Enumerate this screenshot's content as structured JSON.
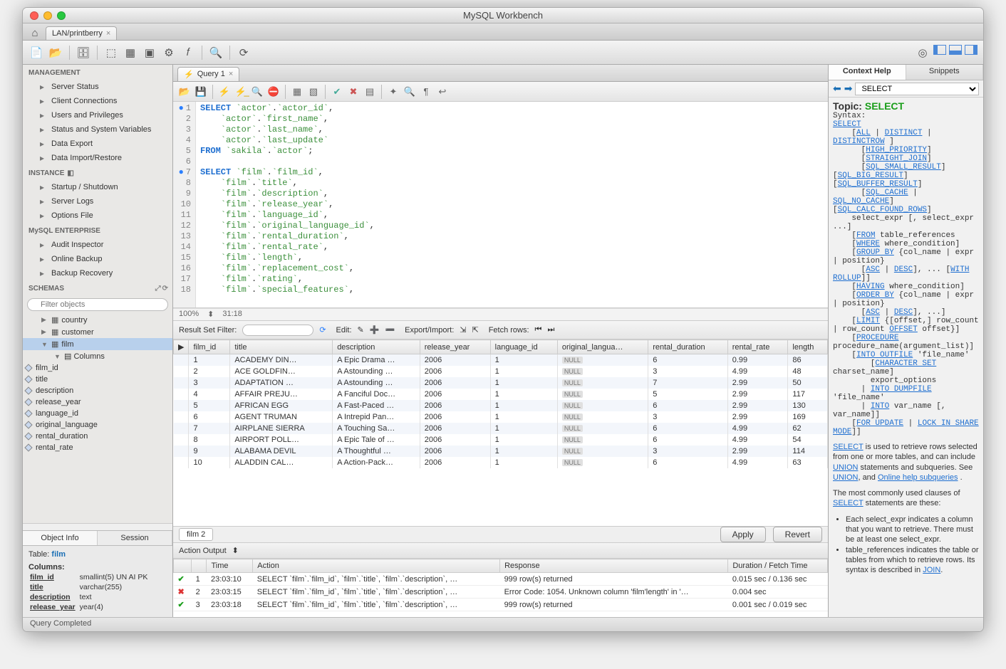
{
  "window_title": "MySQL Workbench",
  "connection_tab": "LAN/printberry",
  "sidebar": {
    "management_header": "MANAGEMENT",
    "management": [
      "Server Status",
      "Client Connections",
      "Users and Privileges",
      "Status and System Variables",
      "Data Export",
      "Data Import/Restore"
    ],
    "instance_header": "INSTANCE",
    "instance": [
      "Startup / Shutdown",
      "Server Logs",
      "Options File"
    ],
    "enterprise_header": "MySQL ENTERPRISE",
    "enterprise": [
      "Audit Inspector",
      "Online Backup",
      "Backup Recovery"
    ],
    "schemas_header": "SCHEMAS",
    "filter_placeholder": "Filter objects",
    "tree": {
      "tables": [
        "country",
        "customer",
        "film"
      ],
      "film_section": "Columns",
      "film_cols": [
        "film_id",
        "title",
        "description",
        "release_year",
        "language_id",
        "original_language",
        "rental_duration",
        "rental_rate"
      ]
    },
    "info_tabs": [
      "Object Info",
      "Session"
    ],
    "object_info": {
      "table_label": "Table:",
      "table_name": "film",
      "columns_label": "Columns:",
      "rows": [
        {
          "name": "film_id",
          "type": "smallint(5) UN AI PK"
        },
        {
          "name": "title",
          "type": "varchar(255)"
        },
        {
          "name": "description",
          "type": "text"
        },
        {
          "name": "release_year",
          "type": "year(4)"
        }
      ]
    }
  },
  "query": {
    "tab": "Query 1",
    "zoom": "100%",
    "cursor": "31:18",
    "lines": [
      {
        "n": 1,
        "dot": true,
        "html": "<span class='kw'>SELECT</span> <span class='bq'>`actor`</span>.<span class='bq'>`actor_id`</span>,"
      },
      {
        "n": 2,
        "html": "    <span class='bq'>`actor`</span>.<span class='bq'>`first_name`</span>,"
      },
      {
        "n": 3,
        "html": "    <span class='bq'>`actor`</span>.<span class='bq'>`last_name`</span>,"
      },
      {
        "n": 4,
        "html": "    <span class='bq'>`actor`</span>.<span class='bq'>`last_update`</span>"
      },
      {
        "n": 5,
        "html": "<span class='kw'>FROM</span> <span class='bq'>`sakila`</span>.<span class='bq'>`actor`</span>;"
      },
      {
        "n": 6,
        "html": ""
      },
      {
        "n": 7,
        "dot": true,
        "html": "<span class='kw'>SELECT</span> <span class='bq'>`film`</span>.<span class='bq'>`film_id`</span>,"
      },
      {
        "n": 8,
        "html": "    <span class='bq'>`film`</span>.<span class='bq'>`title`</span>,"
      },
      {
        "n": 9,
        "html": "    <span class='bq'>`film`</span>.<span class='bq'>`description`</span>,"
      },
      {
        "n": 10,
        "html": "    <span class='bq'>`film`</span>.<span class='bq'>`release_year`</span>,"
      },
      {
        "n": 11,
        "html": "    <span class='bq'>`film`</span>.<span class='bq'>`language_id`</span>,"
      },
      {
        "n": 12,
        "html": "    <span class='bq'>`film`</span>.<span class='bq'>`original_language_id`</span>,"
      },
      {
        "n": 13,
        "html": "    <span class='bq'>`film`</span>.<span class='bq'>`rental_duration`</span>,"
      },
      {
        "n": 14,
        "html": "    <span class='bq'>`film`</span>.<span class='bq'>`rental_rate`</span>,"
      },
      {
        "n": 15,
        "html": "    <span class='bq'>`film`</span>.<span class='bq'>`length`</span>,"
      },
      {
        "n": 16,
        "html": "    <span class='bq'>`film`</span>.<span class='bq'>`replacement_cost`</span>,"
      },
      {
        "n": 17,
        "html": "    <span class='bq'>`film`</span>.<span class='bq'>`rating`</span>,"
      },
      {
        "n": 18,
        "html": "    <span class='bq'>`film`</span>.<span class='bq'>`special_features`</span>,"
      }
    ]
  },
  "rs_filter_label": "Result Set Filter:",
  "edit_label": "Edit:",
  "export_label": "Export/Import:",
  "fetch_label": "Fetch rows:",
  "result": {
    "cols": [
      "film_id",
      "title",
      "description",
      "release_year",
      "language_id",
      "original_langua…",
      "rental_duration",
      "rental_rate",
      "length"
    ],
    "rows": [
      [
        "1",
        "ACADEMY DIN…",
        "A Epic Drama …",
        "2006",
        "1",
        "NULL",
        "6",
        "0.99",
        "86"
      ],
      [
        "2",
        "ACE GOLDFIN…",
        "A Astounding …",
        "2006",
        "1",
        "NULL",
        "3",
        "4.99",
        "48"
      ],
      [
        "3",
        "ADAPTATION …",
        "A Astounding …",
        "2006",
        "1",
        "NULL",
        "7",
        "2.99",
        "50"
      ],
      [
        "4",
        "AFFAIR PREJU…",
        "A Fanciful Doc…",
        "2006",
        "1",
        "NULL",
        "5",
        "2.99",
        "117"
      ],
      [
        "5",
        "AFRICAN EGG",
        "A Fast-Paced …",
        "2006",
        "1",
        "NULL",
        "6",
        "2.99",
        "130"
      ],
      [
        "6",
        "AGENT TRUMAN",
        "A Intrepid Pan…",
        "2006",
        "1",
        "NULL",
        "3",
        "2.99",
        "169"
      ],
      [
        "7",
        "AIRPLANE SIERRA",
        "A Touching Sa…",
        "2006",
        "1",
        "NULL",
        "6",
        "4.99",
        "62"
      ],
      [
        "8",
        "AIRPORT POLL…",
        "A Epic Tale of …",
        "2006",
        "1",
        "NULL",
        "6",
        "4.99",
        "54"
      ],
      [
        "9",
        "ALABAMA DEVIL",
        "A Thoughtful …",
        "2006",
        "1",
        "NULL",
        "3",
        "2.99",
        "114"
      ],
      [
        "10",
        "ALADDIN CAL…",
        "A Action-Pack…",
        "2006",
        "1",
        "NULL",
        "6",
        "4.99",
        "63"
      ]
    ],
    "tab": "film 2",
    "apply": "Apply",
    "revert": "Revert"
  },
  "action_output": {
    "header": "Action Output",
    "cols": [
      "",
      "",
      "Time",
      "Action",
      "Response",
      "Duration / Fetch Time"
    ],
    "rows": [
      {
        "status": "ok",
        "n": "1",
        "time": "23:03:10",
        "action": "SELECT `film`.`film_id`,     `film`.`title`,     `film`.`description`,  …",
        "resp": "999 row(s) returned",
        "dur": "0.015 sec / 0.136 sec"
      },
      {
        "status": "err",
        "n": "2",
        "time": "23:03:15",
        "action": "SELECT `film`.`film_id`,     `film`.`title`,     `film`.`description`,  …",
        "resp": "Error Code: 1054. Unknown column 'film'length' in '…",
        "dur": "0.004 sec"
      },
      {
        "status": "ok",
        "n": "3",
        "time": "23:03:18",
        "action": "SELECT `film`.`film_id`,     `film`.`title`,     `film`.`description`,  …",
        "resp": "999 row(s) returned",
        "dur": "0.001 sec / 0.019 sec"
      }
    ]
  },
  "statusbar": "Query Completed",
  "help": {
    "tabs": [
      "Context Help",
      "Snippets"
    ],
    "topic_select": "SELECT",
    "topic_label": "Topic:",
    "topic": "SELECT",
    "desc1": "SELECT is used to retrieve rows selected from one or more tables, and can include UNION statements and subqueries. See UNION, and Online help subqueries .",
    "desc2": "The most commonly used clauses of SELECT statements are these:",
    "bullets": [
      "Each select_expr indicates a column that you want to retrieve. There must be at least one select_expr.",
      "table_references indicates the table or tables from which to retrieve rows. Its syntax is described in JOIN."
    ]
  }
}
